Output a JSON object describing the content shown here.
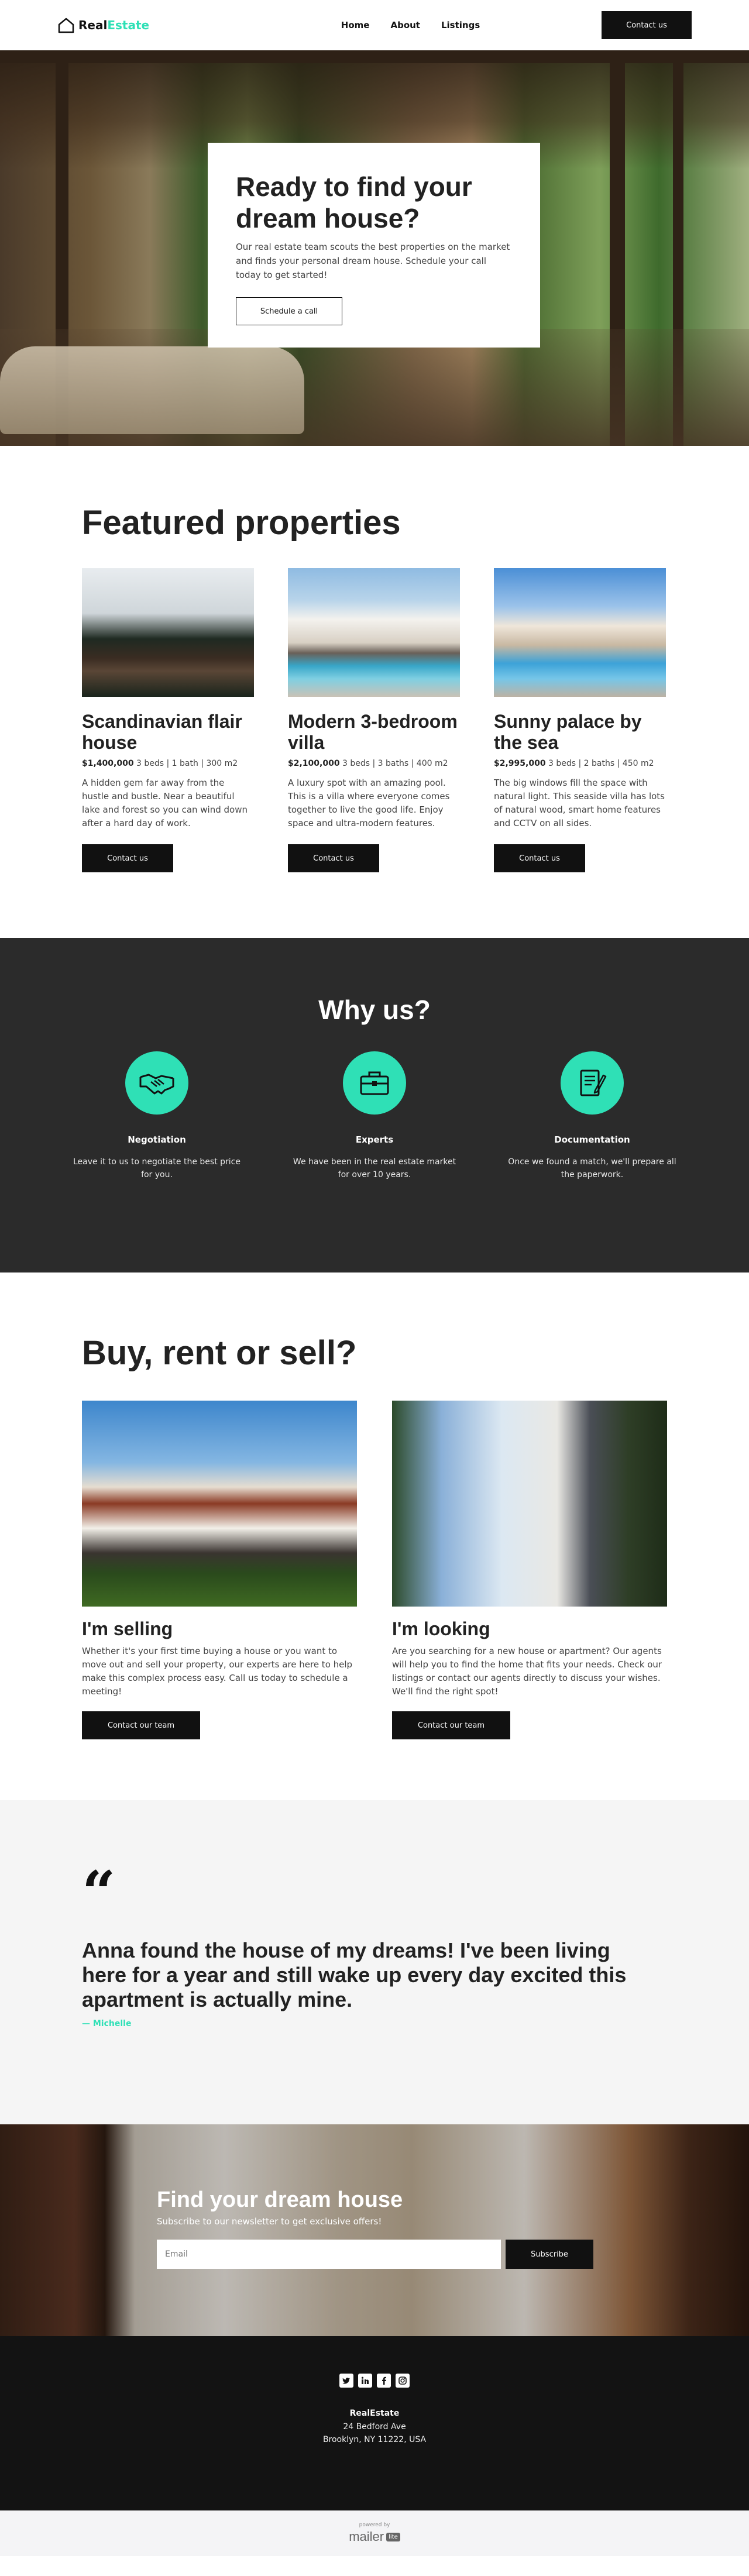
{
  "header": {
    "logo_part1": "Real",
    "logo_part2": "Estate",
    "nav": [
      "Home",
      "About",
      "Listings"
    ],
    "cta": "Contact us"
  },
  "hero": {
    "title": "Ready to find your dream house?",
    "text": "Our real estate team scouts the best properties on the market and finds your personal dream house. Schedule your call today to get started!",
    "button": "Schedule a call"
  },
  "featured": {
    "title": "Featured properties",
    "items": [
      {
        "name": "Scandinavian flair house",
        "price": "$1,400,000",
        "specs": "3 beds | 1 bath | 300 m2",
        "desc": "A hidden gem far away from the hustle and bustle. Near a beautiful lake and forest so you can wind down after a hard day of work.",
        "button": "Contact us"
      },
      {
        "name": "Modern 3-bedroom villa",
        "price": "$2,100,000",
        "specs": "3 beds | 3 baths | 400 m2",
        "desc": "A luxury spot with an amazing pool. This is a villa where everyone comes together to live the good life. Enjoy space and ultra-modern features.",
        "button": "Contact us"
      },
      {
        "name": "Sunny palace by the sea",
        "price": "$2,995,000",
        "specs": "3 beds | 2 baths | 450 m2",
        "desc": "The big windows fill the space with natural light. This seaside villa has lots of natural wood, smart home features and CCTV on all sides.",
        "button": "Contact us"
      }
    ]
  },
  "why": {
    "title": "Why us?",
    "items": [
      {
        "icon": "handshake-icon",
        "title": "Negotiation",
        "text": "Leave it to us to negotiate the best price for you."
      },
      {
        "icon": "briefcase-icon",
        "title": "Experts",
        "text": "We have been in the real estate market for over 10 years."
      },
      {
        "icon": "document-icon",
        "title": "Documentation",
        "text": "Once we found a match, we'll prepare all the paperwork."
      }
    ]
  },
  "buy": {
    "title": "Buy, rent or sell?",
    "cols": [
      {
        "title": "I'm selling",
        "text": "Whether it's your first time buying a house or you want to move out and sell your property, our experts are here to help make this complex process easy. Call us today to schedule a meeting!",
        "button": "Contact our team"
      },
      {
        "title": "I'm looking",
        "text": "Are you searching for a new house or apartment? Our agents will help you to find the home that fits your needs. Check our listings or contact our agents directly to discuss your wishes. We'll find the right spot!",
        "button": "Contact our team"
      }
    ]
  },
  "testimonial": {
    "quote": "Anna found the house of my dreams! I've been living here for a year and still wake up every day excited this apartment is actually mine.",
    "author": "— Michelle"
  },
  "newsletter": {
    "title": "Find your dream house",
    "subtitle": "Subscribe to our newsletter to get exclusive offers!",
    "placeholder": "Email",
    "button": "Subscribe"
  },
  "footer": {
    "socials": [
      "twitter-icon",
      "linkedin-icon",
      "facebook-icon",
      "instagram-icon"
    ],
    "brand": "RealEstate",
    "address1": "24 Bedford Ave",
    "address2": "Brooklyn, NY 11222, USA"
  },
  "mailer": {
    "powered": "powered by",
    "name": "mailer",
    "lite": "lite"
  },
  "colors": {
    "accent": "#2fe0b6",
    "dark": "#111111",
    "section_dark": "#2b2b2b"
  }
}
